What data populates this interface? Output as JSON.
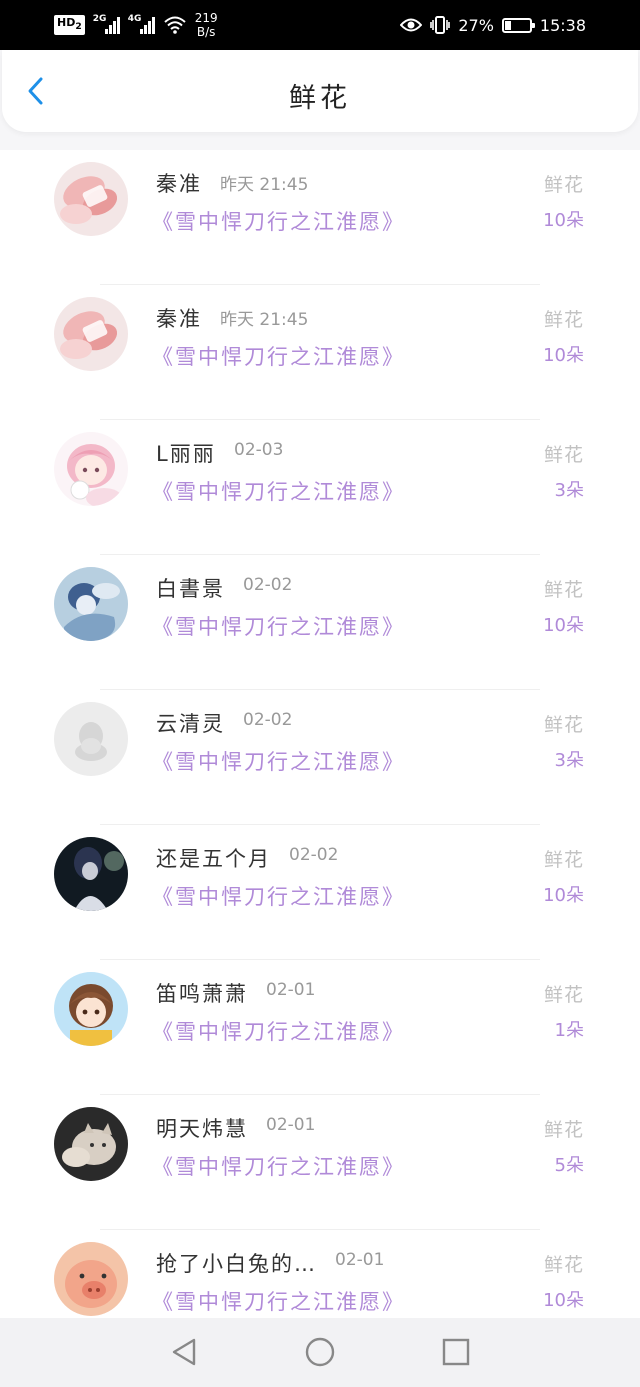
{
  "status_bar": {
    "hd": "HD",
    "hd_sub": "2",
    "net1": "2G",
    "net2": "4G",
    "speed_value": "219",
    "speed_unit": "B/s",
    "battery_percent": "27%",
    "battery_level": 0.27,
    "time": "15:38",
    "icons": [
      "eye-icon",
      "vibrate-icon",
      "battery-icon",
      "wifi-icon",
      "signal-icon"
    ]
  },
  "header": {
    "title": "鲜花",
    "back_icon": "chevron-left-icon",
    "accent_color": "#1e90e8"
  },
  "colors": {
    "book": "#b08ad8",
    "muted": "#c2c2c2",
    "name": "#333333",
    "time": "#999999"
  },
  "list": {
    "items": [
      {
        "name": "秦准",
        "time": "昨天 21:45",
        "book": "《雪中悍刀行之江淮愿》",
        "type": "鲜花",
        "count": "10朵",
        "avatar": "hand-photo-avatar"
      },
      {
        "name": "秦准",
        "time": "昨天 21:45",
        "book": "《雪中悍刀行之江淮愿》",
        "type": "鲜花",
        "count": "10朵",
        "avatar": "hand-photo-avatar"
      },
      {
        "name": "L丽丽",
        "time": "02-03",
        "book": "《雪中悍刀行之江淮愿》",
        "type": "鲜花",
        "count": "3朵",
        "avatar": "pink-anime-girl-avatar"
      },
      {
        "name": "白書景",
        "time": "02-02",
        "book": "《雪中悍刀行之江淮愿》",
        "type": "鲜花",
        "count": "10朵",
        "avatar": "blue-anime-avatar"
      },
      {
        "name": "云清灵",
        "time": "02-02",
        "book": "《雪中悍刀行之江淮愿》",
        "type": "鲜花",
        "count": "3朵",
        "avatar": "default-penguin-avatar"
      },
      {
        "name": "还是五个月",
        "time": "02-02",
        "book": "《雪中悍刀行之江淮愿》",
        "type": "鲜花",
        "count": "10朵",
        "avatar": "dark-anime-avatar"
      },
      {
        "name": "笛鸣萧萧",
        "time": "02-01",
        "book": "《雪中悍刀行之江淮愿》",
        "type": "鲜花",
        "count": "1朵",
        "avatar": "brown-hair-girl-avatar"
      },
      {
        "name": "明天炜慧",
        "time": "02-01",
        "book": "《雪中悍刀行之江淮愿》",
        "type": "鲜花",
        "count": "5朵",
        "avatar": "cat-photo-avatar"
      },
      {
        "name": "抢了小白兔的…",
        "time": "02-01",
        "book": "《雪中悍刀行之江淮愿》",
        "type": "鲜花",
        "count": "10朵",
        "avatar": "pig-photo-avatar"
      }
    ]
  },
  "navbar": {
    "icons": [
      "back-triangle-icon",
      "home-circle-icon",
      "recents-square-icon"
    ]
  }
}
